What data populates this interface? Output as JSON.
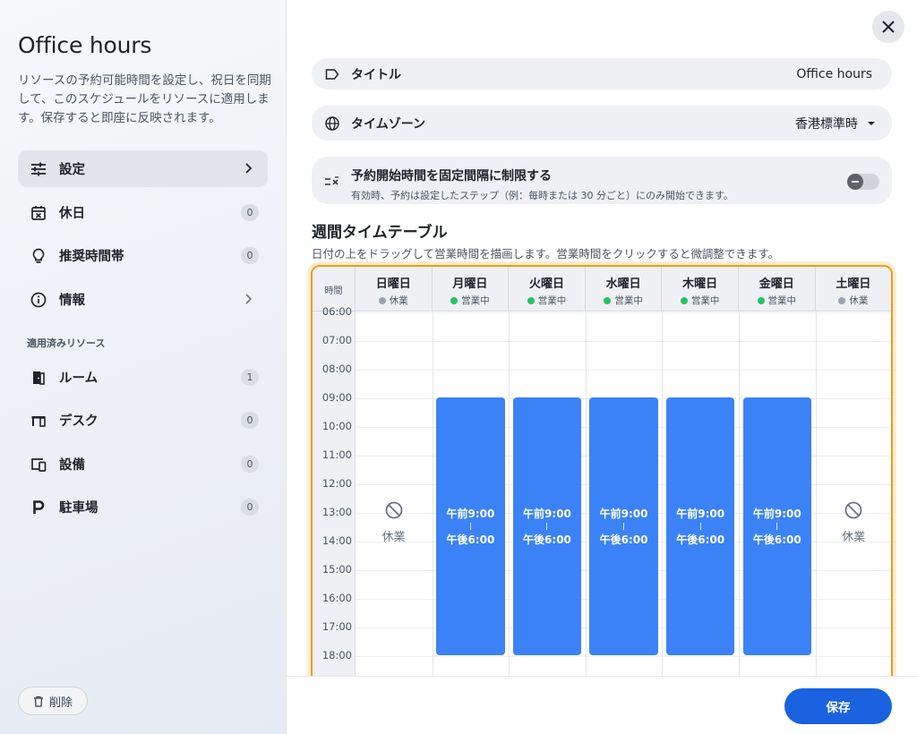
{
  "sidebar": {
    "title": "Office hours",
    "description": "リソースの予約可能時間を設定し、祝日を同期して、このスケジュールをリソースに適用します。保存すると即座に反映されます。",
    "items": [
      {
        "label": "設定",
        "icon": "sliders-icon",
        "active": true
      },
      {
        "label": "休日",
        "icon": "calendar-x-icon",
        "count": "0"
      },
      {
        "label": "推奨時間帯",
        "icon": "lightbulb-icon",
        "count": "0"
      },
      {
        "label": "情報",
        "icon": "info-icon"
      }
    ],
    "section_label": "適用済みリソース",
    "resources": [
      {
        "label": "ルーム",
        "icon": "door-icon",
        "count": "1"
      },
      {
        "label": "デスク",
        "icon": "desk-icon",
        "count": "0"
      },
      {
        "label": "設備",
        "icon": "devices-icon",
        "count": "0"
      },
      {
        "label": "駐車場",
        "icon": "parking-icon",
        "count": "0"
      }
    ],
    "delete_label": "削除"
  },
  "form": {
    "title_label": "タイトル",
    "title_value": "Office hours",
    "timezone_label": "タイムゾーン",
    "timezone_value": "香港標準時",
    "restrict_label": "予約開始時間を固定間隔に制限する",
    "restrict_desc": "有効時、予約は設定したステップ（例：毎時または 30 分ごと）にのみ開始できます。",
    "restrict_enabled": false
  },
  "timetable": {
    "title": "週間タイムテーブル",
    "description": "日付の上をドラッグして営業時間を描画します。営業時間をクリックすると微調整できます。",
    "time_header": "時間",
    "times": [
      "06:00",
      "07:00",
      "08:00",
      "09:00",
      "10:00",
      "11:00",
      "12:00",
      "13:00",
      "14:00",
      "15:00",
      "16:00",
      "17:00",
      "18:00"
    ],
    "closed_label": "休業",
    "open_status_color": "#22c55e",
    "closed_status_color": "#9ca3af",
    "days": [
      {
        "name": "日曜日",
        "status": "休業",
        "open": false
      },
      {
        "name": "月曜日",
        "status": "営業中",
        "open": true,
        "start": "午前9:00",
        "end": "午後6:00"
      },
      {
        "name": "火曜日",
        "status": "営業中",
        "open": true,
        "start": "午前9:00",
        "end": "午後6:00"
      },
      {
        "name": "水曜日",
        "status": "営業中",
        "open": true,
        "start": "午前9:00",
        "end": "午後6:00"
      },
      {
        "name": "木曜日",
        "status": "営業中",
        "open": true,
        "start": "午前9:00",
        "end": "午後6:00"
      },
      {
        "name": "金曜日",
        "status": "営業中",
        "open": true,
        "start": "午前9:00",
        "end": "午後6:00"
      },
      {
        "name": "土曜日",
        "status": "休業",
        "open": false
      }
    ]
  },
  "save_label": "保存",
  "accent_color": "#3b82f6",
  "highlight_color": "#f39c12"
}
